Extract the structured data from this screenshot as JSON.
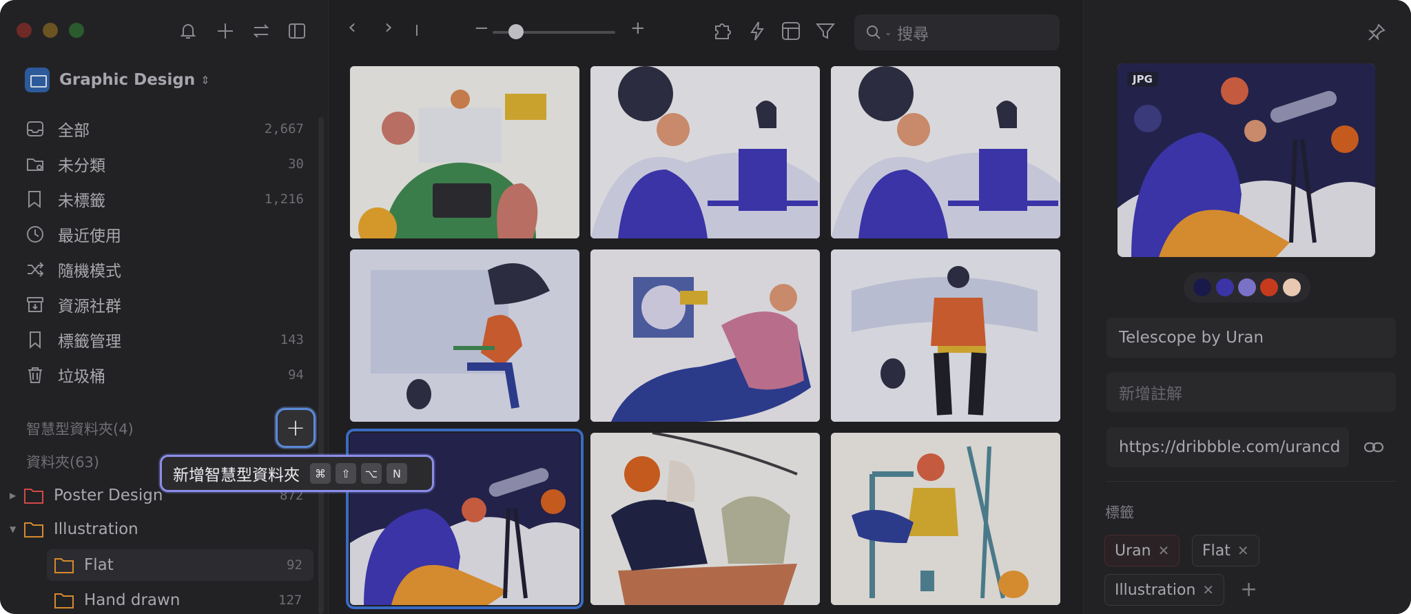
{
  "sidebar": {
    "library": {
      "name": "Graphic Design",
      "chevron": "⌃"
    },
    "nav": [
      {
        "label": "全部",
        "count": "2,667",
        "icon": "inbox-icon"
      },
      {
        "label": "未分類",
        "count": "30",
        "icon": "folder-question-icon"
      },
      {
        "label": "未標籤",
        "count": "1,216",
        "icon": "tag-question-icon"
      },
      {
        "label": "最近使用",
        "count": "",
        "icon": "clock-icon"
      },
      {
        "label": "隨機模式",
        "count": "",
        "icon": "shuffle-icon"
      },
      {
        "label": "資源社群",
        "count": "",
        "icon": "archive-icon"
      },
      {
        "label": "標籤管理",
        "count": "143",
        "icon": "bookmark-icon"
      },
      {
        "label": "垃圾桶",
        "count": "94",
        "icon": "trash-icon"
      }
    ],
    "smart_folders_label": "智慧型資料夾(4)",
    "folders_label": "資料夾(63)",
    "folders": [
      {
        "label": "Poster Design",
        "count": "872",
        "color": "#d14a46"
      },
      {
        "label": "Illustration",
        "count": "",
        "color": "#d68a2e"
      },
      {
        "label": "Flat",
        "count": "92",
        "color": "#d68a2e"
      },
      {
        "label": "Hand drawn",
        "count": "127",
        "color": "#d68a2e"
      }
    ]
  },
  "tooltip": {
    "label": "新增智慧型資料夾",
    "keys": [
      "⌘",
      "⇧",
      "⌥",
      "N"
    ]
  },
  "add_button": {
    "label": "+"
  },
  "toolbar": {
    "back": "‹",
    "forward": "›",
    "zoom_out": "−",
    "zoom_in": "+",
    "zoom_level": 0.18,
    "search_placeholder": "搜尋"
  },
  "inspector": {
    "format_badge": "JPG",
    "palette": [
      "#1a1a4a",
      "#3a34a6",
      "#7a72c8",
      "#c63a1e",
      "#e8c8b0"
    ],
    "title": "Telescope  by Uran",
    "note_placeholder": "新增註解",
    "url": "https://dribbble.com/urancd",
    "tags_title": "標籤",
    "tags": [
      "Uran",
      "Flat",
      "Illustration"
    ]
  }
}
